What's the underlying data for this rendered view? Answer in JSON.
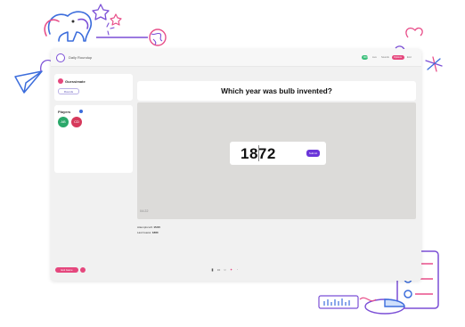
{
  "app": {
    "name": "Daily Roundup",
    "header_pills": [
      "00:00",
      "Live",
      "Sounds",
      "Options",
      "End"
    ]
  },
  "sidebar": {
    "gamemode_title": "Guessimate",
    "gamemode_button": "Rounds",
    "players_title": "Players",
    "players": [
      {
        "initials": "AB",
        "color": "#2aa86a"
      },
      {
        "initials": "CD",
        "color": "#d63a5c"
      }
    ]
  },
  "main": {
    "question": "Which year was bulb invented?",
    "answer_value": "1872",
    "submit_label": "Submit",
    "timer": "04:22",
    "attempts_label": "Attempts left:",
    "attempts_value": "15/15",
    "last_guess_label": "Last Guess:",
    "last_guess_value": "1880"
  },
  "footer": {
    "leave_label": "Exit Game",
    "tools": [
      "mic-icon",
      "camera-icon",
      "chat-icon",
      "reaction-icon",
      "more-icon"
    ]
  },
  "colors": {
    "accent": "#6a35d9",
    "pink": "#e5477d",
    "green": "#2aa86a",
    "red": "#d63a5c"
  }
}
